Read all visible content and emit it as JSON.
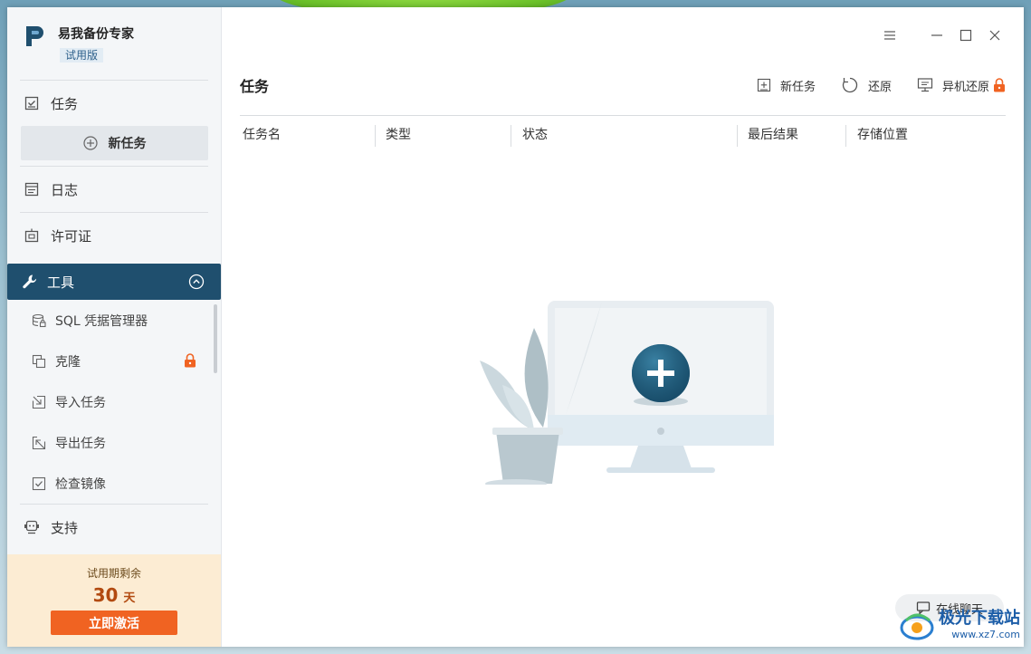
{
  "app": {
    "name": "易我备份专家",
    "badge": "试用版"
  },
  "sidebar": {
    "items": [
      {
        "label": "任务",
        "icon": "checklist-icon"
      },
      {
        "label": "日志",
        "icon": "log-icon"
      },
      {
        "label": "许可证",
        "icon": "license-icon"
      },
      {
        "label": "工具",
        "icon": "wrench-icon"
      },
      {
        "label": "支持",
        "icon": "support-icon"
      }
    ],
    "new_task": "新任务",
    "tools_sub": [
      {
        "label": "SQL 凭据管理器",
        "icon": "database-lock-icon"
      },
      {
        "label": "克隆",
        "icon": "clone-icon",
        "locked": true
      },
      {
        "label": "导入任务",
        "icon": "import-icon"
      },
      {
        "label": "导出任务",
        "icon": "export-icon"
      },
      {
        "label": "检查镜像",
        "icon": "check-image-icon"
      }
    ]
  },
  "trial": {
    "label": "试用期剩余",
    "days": "30",
    "unit": "天",
    "activate": "立即激活"
  },
  "main": {
    "title": "任务",
    "toolbar": {
      "new_task": "新任务",
      "restore": "还原",
      "remote_restore": "异机还原"
    },
    "columns": [
      "任务名",
      "类型",
      "状态",
      "最后结果",
      "存储位置"
    ]
  },
  "chat": {
    "label": "在线聊天"
  },
  "watermark": {
    "text": "极光下载站",
    "url": "www.xz7.com"
  },
  "colors": {
    "accent": "#1f4f6e",
    "activate": "#f06322",
    "lock": "#f06322",
    "trial_bg": "#fcecd3"
  }
}
